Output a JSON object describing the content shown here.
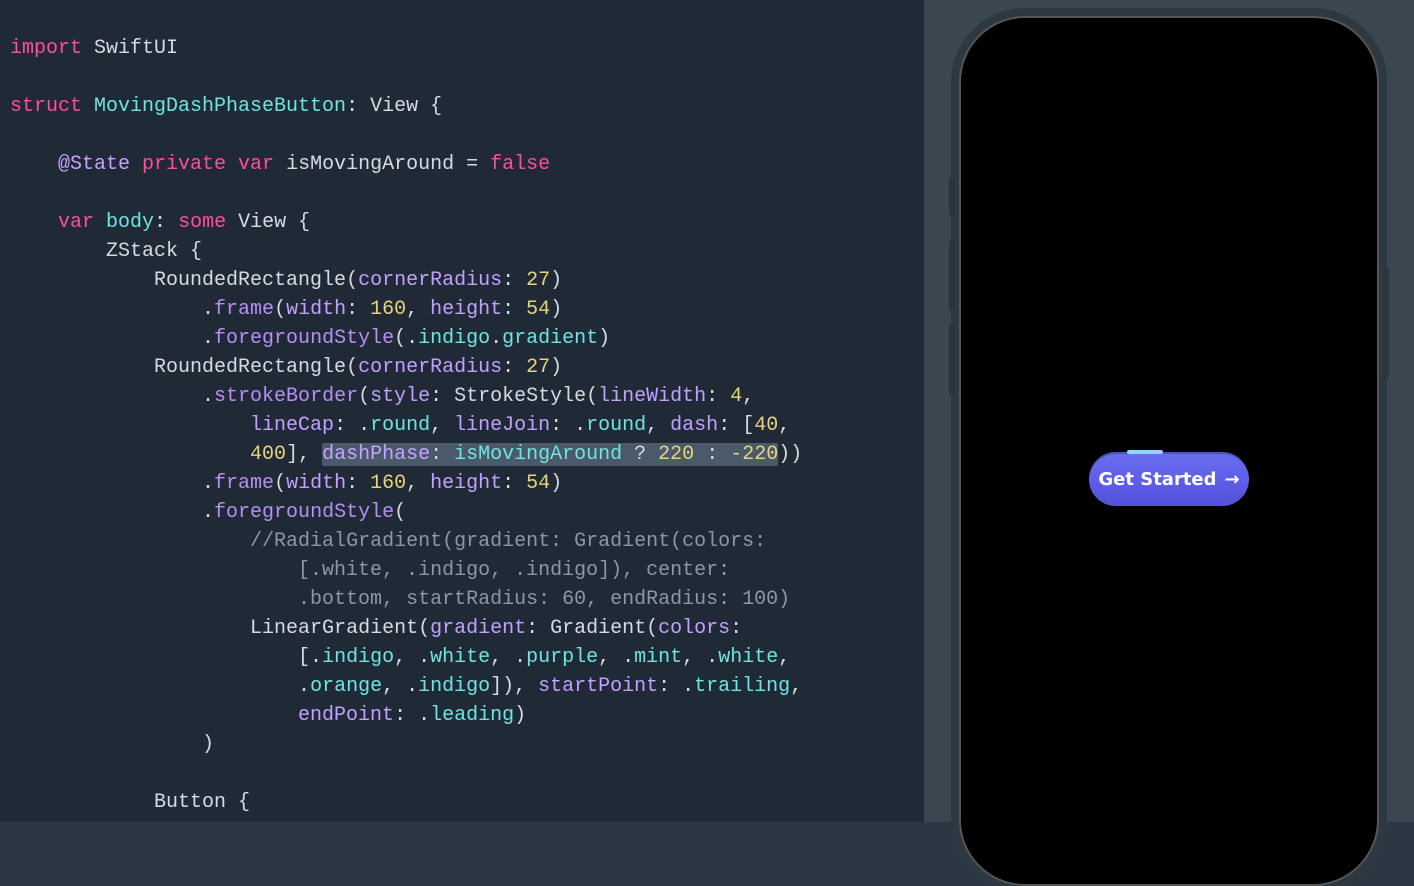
{
  "code": {
    "l1_import": "import",
    "l1_module": " SwiftUI",
    "l3_struct": "struct",
    "l3_name": " MovingDashPhaseButton",
    "l3_tail": ": View {",
    "l5_atstate": "@State ",
    "l5_private": "private",
    "l5_var": " var ",
    "l5_ident": "isMovingAround",
    "l5_eq": " = ",
    "l5_false": "false",
    "l7_var": "var",
    "l7_body": " body",
    "l7_colon": ": ",
    "l7_some": "some",
    "l7_view": " View {",
    "l8": "ZStack {",
    "l9_a": "RoundedRectangle(",
    "l9_p": "cornerRadius",
    "l9_b": ": ",
    "l9_n": "27",
    "l9_c": ")",
    "l10_a": ".",
    "l10_f": "frame",
    "l10_b": "(",
    "l10_p1": "width",
    "l10_c": ": ",
    "l10_n1": "160",
    "l10_d": ", ",
    "l10_p2": "height",
    "l10_e": ": ",
    "l10_n2": "54",
    "l10_g": ")",
    "l11_a": ".",
    "l11_f": "foregroundStyle",
    "l11_b": "(.",
    "l11_p1": "indigo",
    "l11_c": ".",
    "l11_p2": "gradient",
    "l11_d": ")",
    "l12_a": "RoundedRectangle(",
    "l12_p": "cornerRadius",
    "l12_b": ": ",
    "l12_n": "27",
    "l12_c": ")",
    "l13_a": ".",
    "l13_f": "strokeBorder",
    "l13_b": "(",
    "l13_p": "style",
    "l13_c": ": StrokeStyle(",
    "l13_p2": "lineWidth",
    "l13_d": ": ",
    "l13_n": "4",
    "l13_e": ",",
    "l14_p1": "lineCap",
    "l14_a": ": .",
    "l14_v1": "round",
    "l14_b": ", ",
    "l14_p2": "lineJoin",
    "l14_c": ": .",
    "l14_v2": "round",
    "l14_d": ", ",
    "l14_p3": "dash",
    "l14_e": ": [",
    "l14_n1": "40",
    "l14_f": ",",
    "l15_n1": "400",
    "l15_a": "], ",
    "l15_sel_p": "dashPhase",
    "l15_sel_a": ": ",
    "l15_sel_id": "isMovingAround",
    "l15_sel_b": " ? ",
    "l15_sel_n1": "220",
    "l15_sel_c": " : ",
    "l15_sel_n2": "-220",
    "l15_tail": "))",
    "l16_a": ".",
    "l16_f": "frame",
    "l16_b": "(",
    "l16_p1": "width",
    "l16_c": ": ",
    "l16_n1": "160",
    "l16_d": ", ",
    "l16_p2": "height",
    "l16_e": ": ",
    "l16_n2": "54",
    "l16_g": ")",
    "l17_a": ".",
    "l17_f": "foregroundStyle",
    "l17_b": "(",
    "l18": "//RadialGradient(gradient: Gradient(colors:",
    "l19": "[.white, .indigo, .indigo]), center:",
    "l20": ".bottom, startRadius: 60, endRadius: 100)",
    "l21_a": "LinearGradient(",
    "l21_p": "gradient",
    "l21_b": ": Gradient(",
    "l21_p2": "colors",
    "l21_c": ":",
    "l22_a": "[.",
    "l22_c1": "indigo",
    "l22_b": ", .",
    "l22_c2": "white",
    "l22_d": ", .",
    "l22_c3": "purple",
    "l22_e": ", .",
    "l22_c4": "mint",
    "l22_f": ", .",
    "l22_c5": "white",
    "l22_g": ",",
    "l23_a": ".",
    "l23_c1": "orange",
    "l23_b": ", .",
    "l23_c2": "indigo",
    "l23_c": "]), ",
    "l23_p1": "startPoint",
    "l23_d": ": .",
    "l23_v1": "trailing",
    "l23_e": ",",
    "l24_p": "endPoint",
    "l24_a": ": .",
    "l24_v": "leading",
    "l24_b": ")",
    "l25": ")",
    "l27": "Button {"
  },
  "preview": {
    "button_label": "Get Started",
    "arrow": "→"
  },
  "colors": {
    "editor_bg": "#1f2a36",
    "preview_bg": "#3a4650",
    "button_grad_top": "#6a6ef0",
    "button_grad_bottom": "#5250d8"
  }
}
